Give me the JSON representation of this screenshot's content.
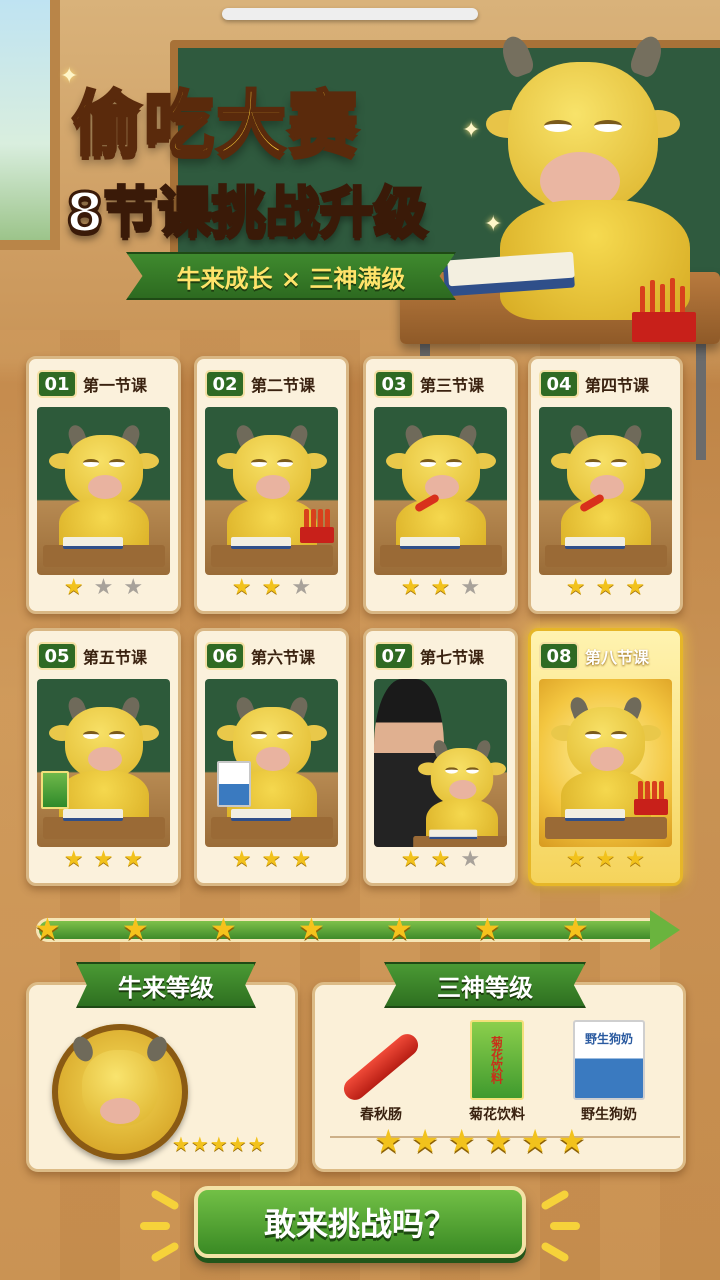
{
  "title": {
    "main": "偷吃大赛",
    "sub": "8节课挑战升级",
    "ribbon": "牛来成长 × 三神满级"
  },
  "lessons": [
    {
      "num": "01",
      "label": "第一节课",
      "stars": 1,
      "max_stars": 3,
      "props": "none"
    },
    {
      "num": "02",
      "label": "第二节课",
      "stars": 2,
      "max_stars": 3,
      "props": "fries"
    },
    {
      "num": "03",
      "label": "第三节课",
      "stars": 2,
      "max_stars": 3,
      "props": "sausage"
    },
    {
      "num": "04",
      "label": "第四节课",
      "stars": 3,
      "max_stars": 3,
      "props": "sausage"
    },
    {
      "num": "05",
      "label": "第五节课",
      "stars": 3,
      "max_stars": 3,
      "props": "juice"
    },
    {
      "num": "06",
      "label": "第六节课",
      "stars": 3,
      "max_stars": 3,
      "props": "milk"
    },
    {
      "num": "07",
      "label": "第七节课",
      "stars": 2,
      "max_stars": 3,
      "props": "teacher"
    },
    {
      "num": "08",
      "label": "第八节课",
      "stars": 3,
      "max_stars": 3,
      "props": "fries",
      "highlight": true
    }
  ],
  "progress": {
    "star_count": 7
  },
  "niulai_level": {
    "label": "牛来等级",
    "stars": "★★★★★"
  },
  "sanshen_level": {
    "label": "三神等级",
    "items": [
      {
        "name": "春秋肠",
        "icon": "sausage-icon"
      },
      {
        "name": "菊花饮料",
        "icon": "chrysanthemum-drink-icon",
        "pack_text": "菊花饮料"
      },
      {
        "name": "野生狗奶",
        "icon": "wild-dog-milk-icon",
        "pack_text": "野生狗奶"
      }
    ],
    "stars": "★★★★★★"
  },
  "cta": {
    "label": "敢来挑战吗？"
  },
  "colors": {
    "accent_green": "#3a8a24",
    "star_gold": "#f2c21c",
    "title_yellow": "#ffd23a"
  }
}
